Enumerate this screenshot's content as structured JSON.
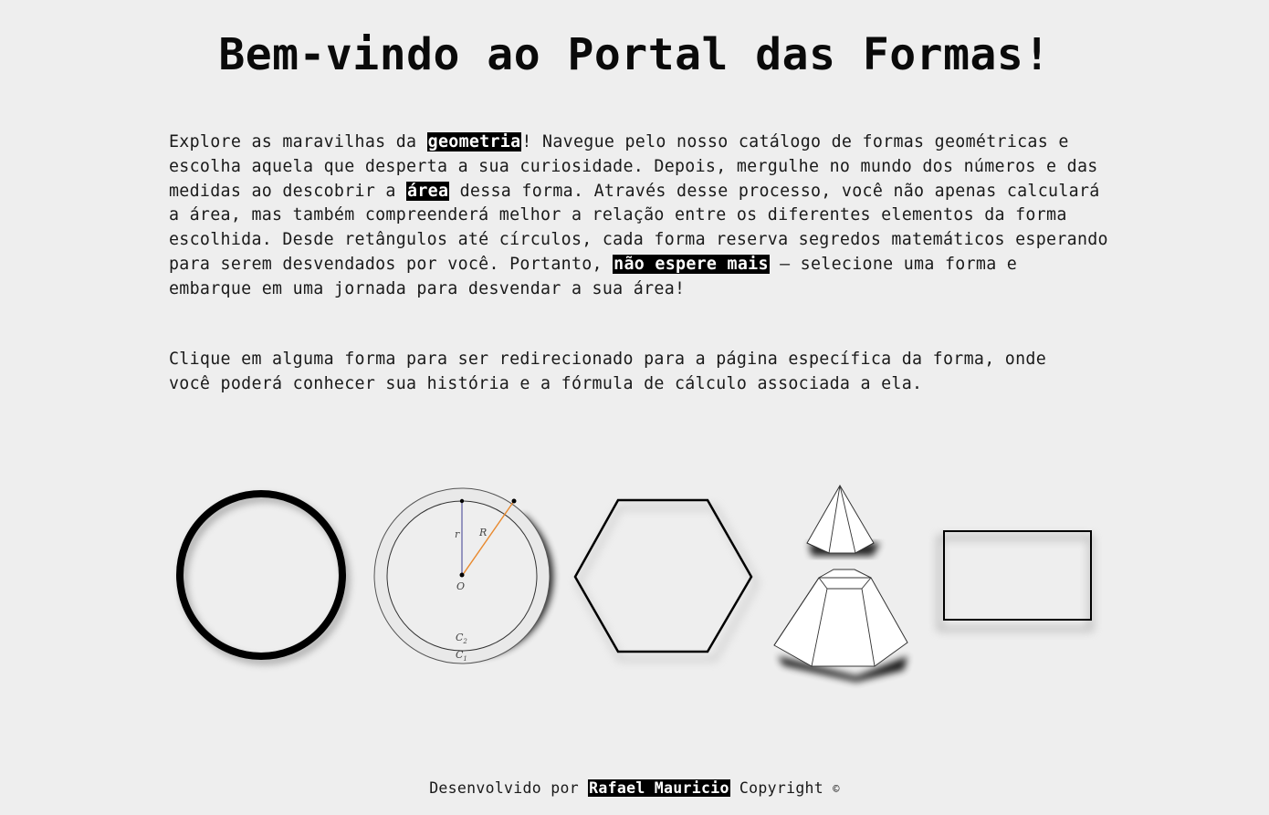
{
  "title": "Bem-vindo ao Portal das Formas!",
  "intro": {
    "part1": "Explore as maravilhas da ",
    "highlight1": "geometria",
    "part2": "! Navegue pelo nosso catálogo de formas geométricas e escolha aquela que desperta a sua curiosidade. Depois, mergulhe no mundo dos números e das medidas ao descobrir a ",
    "highlight2": "área",
    "part3": " dessa forma. Através desse processo, você não apenas calculará a área, mas também compreenderá melhor a relação entre os diferentes elementos da forma escolhida. Desde retângulos até círculos, cada forma reserva segredos matemáticos esperando para serem desvendados por você. Portanto, ",
    "highlight3": "não espere mais",
    "part4": " – selecione uma forma e embarque em uma jornada para desvendar a sua área!"
  },
  "instruction": "Clique em alguma forma para ser redirecionado para a página específica da forma, onde você poderá conhecer sua história e a fórmula de cálculo associada a ela.",
  "shapes": {
    "circle": "circle-icon",
    "annulus": {
      "icon": "annulus-icon",
      "label_r": "r",
      "label_R": "R",
      "label_O": "O",
      "label_C2": "C",
      "label_C2_sub": "2",
      "label_C1": "C",
      "label_C1_sub": "1"
    },
    "hexagon": "hexagon-icon",
    "pyramid_frustum": "frustum-pyramid-icon",
    "rectangle": "rectangle-icon"
  },
  "footer": {
    "prefix": "Desenvolvido por ",
    "author": "Rafael Mauricio",
    "suffix": " Copyright ",
    "copyright_symbol": "©"
  },
  "colors": {
    "background": "#eeeeee",
    "highlight_bg": "#000000",
    "highlight_fg": "#ffffff",
    "radius_r": "#5a5aa0",
    "radius_R": "#e8892e"
  }
}
